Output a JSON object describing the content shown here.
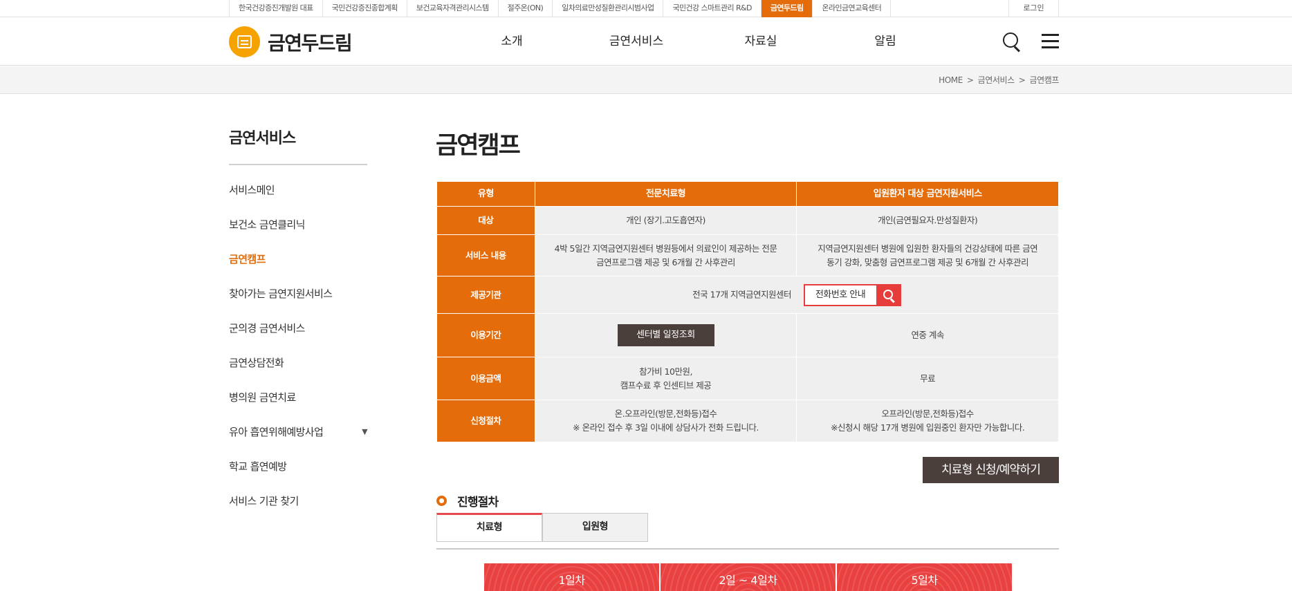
{
  "topbar": {
    "links": [
      {
        "label": "한국건강증진개발원 대표",
        "active": false
      },
      {
        "label": "국민건강증진종합계획",
        "active": false
      },
      {
        "label": "보건교육자격관리시스템",
        "active": false
      },
      {
        "label": "절주온(ON)",
        "active": false
      },
      {
        "label": "일차의료만성질환관리시범사업",
        "active": false
      },
      {
        "label": "국민건강 스마트관리 R&D",
        "active": false
      },
      {
        "label": "금연두드림",
        "active": true
      },
      {
        "label": "온라인금연교육센터",
        "active": false
      }
    ],
    "login": "로그인"
  },
  "header": {
    "logo_text": "금연두드림",
    "nav": [
      "소개",
      "금연서비스",
      "자료실",
      "알림"
    ],
    "icons": [
      "search-icon",
      "menu-icon"
    ]
  },
  "breadcrumb": {
    "items": [
      "HOME",
      ">",
      "금연서비스",
      ">",
      "금연캠프"
    ]
  },
  "sidebar": {
    "title": "금연서비스",
    "items": [
      {
        "label": "서비스메인"
      },
      {
        "label": "보건소 금연클리닉"
      },
      {
        "label": "금연캠프",
        "active": true
      },
      {
        "label": "찾아가는 금연지원서비스"
      },
      {
        "label": "군의경 금연서비스"
      },
      {
        "label": "금연상담전화"
      },
      {
        "label": "병의원 금연치료"
      },
      {
        "label": "유아 흡연위해예방사업",
        "has_submenu": true,
        "arrow": "▼"
      },
      {
        "label": "학교 흡연예방"
      },
      {
        "label": "서비스 기관 찾기"
      }
    ]
  },
  "main": {
    "title": "금연캠프",
    "table": {
      "head": [
        "유형",
        "전문치료형",
        "입원환자 대상 금연지원서비스"
      ],
      "rows": {
        "target": {
          "label": "대상",
          "c1": "개인 (장기.고도흡연자)",
          "c2": "개인(금연필요자.만성질환자)"
        },
        "content": {
          "label": "서비스 내용",
          "c1": [
            "4박 5일간 지역금연지원센터 병원등에서 의료인이 제공하는 전문",
            "금연프로그램 제공 및 6개월 간 사후관리"
          ],
          "c2": [
            "지역금연지원센터 병원에 입원한 환자들의 건강상태에 따른 금연",
            "동기 강화, 맞춤형 금연프로그램 제공 및 6개월 간 사후관리"
          ]
        },
        "provider": {
          "label": "제공기관",
          "text": "전국 17개 지역금연지원센터",
          "phone_button": "전화번호 안내"
        },
        "period": {
          "label": "이용기간",
          "c1_button": "센터별 일정조회",
          "c2": "연중 계속"
        },
        "fee": {
          "label": "이용금액",
          "c1": [
            "참가비 10만원,",
            "캠프수료 후 인센티브 제공"
          ],
          "c2": "무료"
        },
        "apply": {
          "label": "신청절차",
          "c1": [
            "온.오프라인(방문,전화등)접수",
            "※ 온라인 접수 후 3일 이내에 상담사가 전화 드립니다."
          ],
          "c2": [
            "오프라인(방문,전화등)접수",
            "※신청시 해당 17개 병원에 입원중인 환자만 가능합니다."
          ]
        }
      }
    },
    "apply_button": "치료형 신청/예약하기",
    "process": {
      "title": "진행절차",
      "tabs": [
        {
          "label": "치료형",
          "active": true
        },
        {
          "label": "입원형",
          "active": false
        }
      ],
      "days": [
        "1일차",
        "2일 ~ 4일차",
        "5일차"
      ]
    }
  },
  "colors": {
    "accent": "#e46c0a",
    "red": "#e94040",
    "dark_button": "#4b3f3c"
  }
}
